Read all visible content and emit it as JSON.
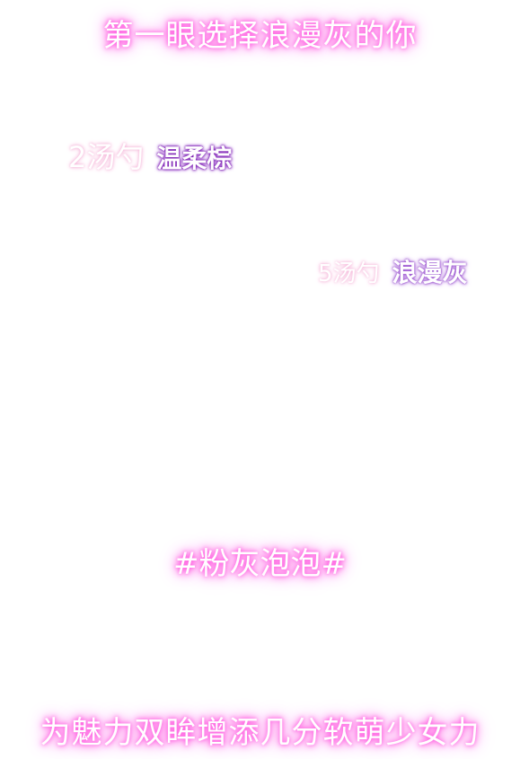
{
  "headline": "第一眼选择浪漫灰的你",
  "doses": [
    {
      "quantity": "2汤勺",
      "shade": "温柔棕",
      "shade_color": "#7a1fb0"
    },
    {
      "quantity": "5汤勺",
      "shade": "浪漫灰",
      "shade_color": "#9a55cf"
    }
  ],
  "hashtag": "#粉灰泡泡#",
  "tagline": "为魅力双眸增添几分软萌少女力",
  "glow_color": "#ff5ee0"
}
